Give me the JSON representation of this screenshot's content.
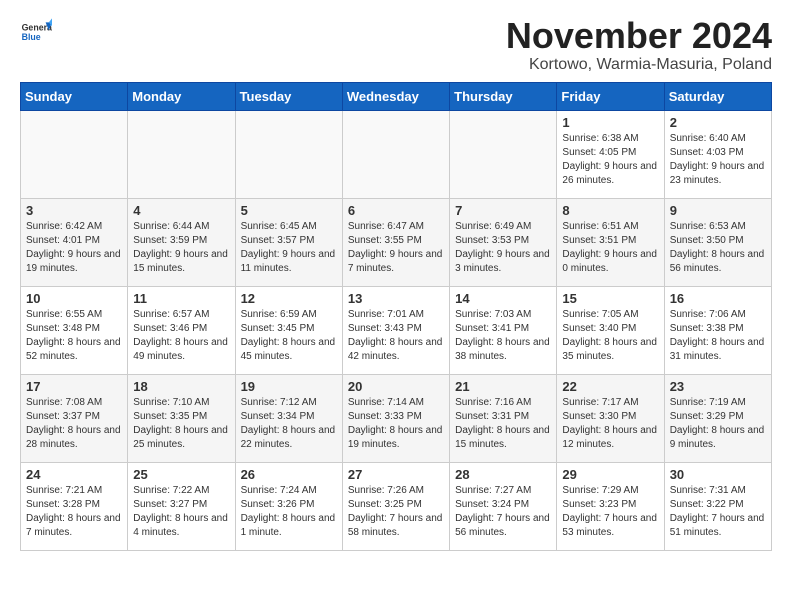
{
  "logo": {
    "general": "General",
    "blue": "Blue"
  },
  "title": "November 2024",
  "location": "Kortowo, Warmia-Masuria, Poland",
  "weekdays": [
    "Sunday",
    "Monday",
    "Tuesday",
    "Wednesday",
    "Thursday",
    "Friday",
    "Saturday"
  ],
  "weeks": [
    [
      {
        "day": "",
        "info": ""
      },
      {
        "day": "",
        "info": ""
      },
      {
        "day": "",
        "info": ""
      },
      {
        "day": "",
        "info": ""
      },
      {
        "day": "",
        "info": ""
      },
      {
        "day": "1",
        "info": "Sunrise: 6:38 AM\nSunset: 4:05 PM\nDaylight: 9 hours and 26 minutes."
      },
      {
        "day": "2",
        "info": "Sunrise: 6:40 AM\nSunset: 4:03 PM\nDaylight: 9 hours and 23 minutes."
      }
    ],
    [
      {
        "day": "3",
        "info": "Sunrise: 6:42 AM\nSunset: 4:01 PM\nDaylight: 9 hours and 19 minutes."
      },
      {
        "day": "4",
        "info": "Sunrise: 6:44 AM\nSunset: 3:59 PM\nDaylight: 9 hours and 15 minutes."
      },
      {
        "day": "5",
        "info": "Sunrise: 6:45 AM\nSunset: 3:57 PM\nDaylight: 9 hours and 11 minutes."
      },
      {
        "day": "6",
        "info": "Sunrise: 6:47 AM\nSunset: 3:55 PM\nDaylight: 9 hours and 7 minutes."
      },
      {
        "day": "7",
        "info": "Sunrise: 6:49 AM\nSunset: 3:53 PM\nDaylight: 9 hours and 3 minutes."
      },
      {
        "day": "8",
        "info": "Sunrise: 6:51 AM\nSunset: 3:51 PM\nDaylight: 9 hours and 0 minutes."
      },
      {
        "day": "9",
        "info": "Sunrise: 6:53 AM\nSunset: 3:50 PM\nDaylight: 8 hours and 56 minutes."
      }
    ],
    [
      {
        "day": "10",
        "info": "Sunrise: 6:55 AM\nSunset: 3:48 PM\nDaylight: 8 hours and 52 minutes."
      },
      {
        "day": "11",
        "info": "Sunrise: 6:57 AM\nSunset: 3:46 PM\nDaylight: 8 hours and 49 minutes."
      },
      {
        "day": "12",
        "info": "Sunrise: 6:59 AM\nSunset: 3:45 PM\nDaylight: 8 hours and 45 minutes."
      },
      {
        "day": "13",
        "info": "Sunrise: 7:01 AM\nSunset: 3:43 PM\nDaylight: 8 hours and 42 minutes."
      },
      {
        "day": "14",
        "info": "Sunrise: 7:03 AM\nSunset: 3:41 PM\nDaylight: 8 hours and 38 minutes."
      },
      {
        "day": "15",
        "info": "Sunrise: 7:05 AM\nSunset: 3:40 PM\nDaylight: 8 hours and 35 minutes."
      },
      {
        "day": "16",
        "info": "Sunrise: 7:06 AM\nSunset: 3:38 PM\nDaylight: 8 hours and 31 minutes."
      }
    ],
    [
      {
        "day": "17",
        "info": "Sunrise: 7:08 AM\nSunset: 3:37 PM\nDaylight: 8 hours and 28 minutes."
      },
      {
        "day": "18",
        "info": "Sunrise: 7:10 AM\nSunset: 3:35 PM\nDaylight: 8 hours and 25 minutes."
      },
      {
        "day": "19",
        "info": "Sunrise: 7:12 AM\nSunset: 3:34 PM\nDaylight: 8 hours and 22 minutes."
      },
      {
        "day": "20",
        "info": "Sunrise: 7:14 AM\nSunset: 3:33 PM\nDaylight: 8 hours and 19 minutes."
      },
      {
        "day": "21",
        "info": "Sunrise: 7:16 AM\nSunset: 3:31 PM\nDaylight: 8 hours and 15 minutes."
      },
      {
        "day": "22",
        "info": "Sunrise: 7:17 AM\nSunset: 3:30 PM\nDaylight: 8 hours and 12 minutes."
      },
      {
        "day": "23",
        "info": "Sunrise: 7:19 AM\nSunset: 3:29 PM\nDaylight: 8 hours and 9 minutes."
      }
    ],
    [
      {
        "day": "24",
        "info": "Sunrise: 7:21 AM\nSunset: 3:28 PM\nDaylight: 8 hours and 7 minutes."
      },
      {
        "day": "25",
        "info": "Sunrise: 7:22 AM\nSunset: 3:27 PM\nDaylight: 8 hours and 4 minutes."
      },
      {
        "day": "26",
        "info": "Sunrise: 7:24 AM\nSunset: 3:26 PM\nDaylight: 8 hours and 1 minute."
      },
      {
        "day": "27",
        "info": "Sunrise: 7:26 AM\nSunset: 3:25 PM\nDaylight: 7 hours and 58 minutes."
      },
      {
        "day": "28",
        "info": "Sunrise: 7:27 AM\nSunset: 3:24 PM\nDaylight: 7 hours and 56 minutes."
      },
      {
        "day": "29",
        "info": "Sunrise: 7:29 AM\nSunset: 3:23 PM\nDaylight: 7 hours and 53 minutes."
      },
      {
        "day": "30",
        "info": "Sunrise: 7:31 AM\nSunset: 3:22 PM\nDaylight: 7 hours and 51 minutes."
      }
    ]
  ]
}
